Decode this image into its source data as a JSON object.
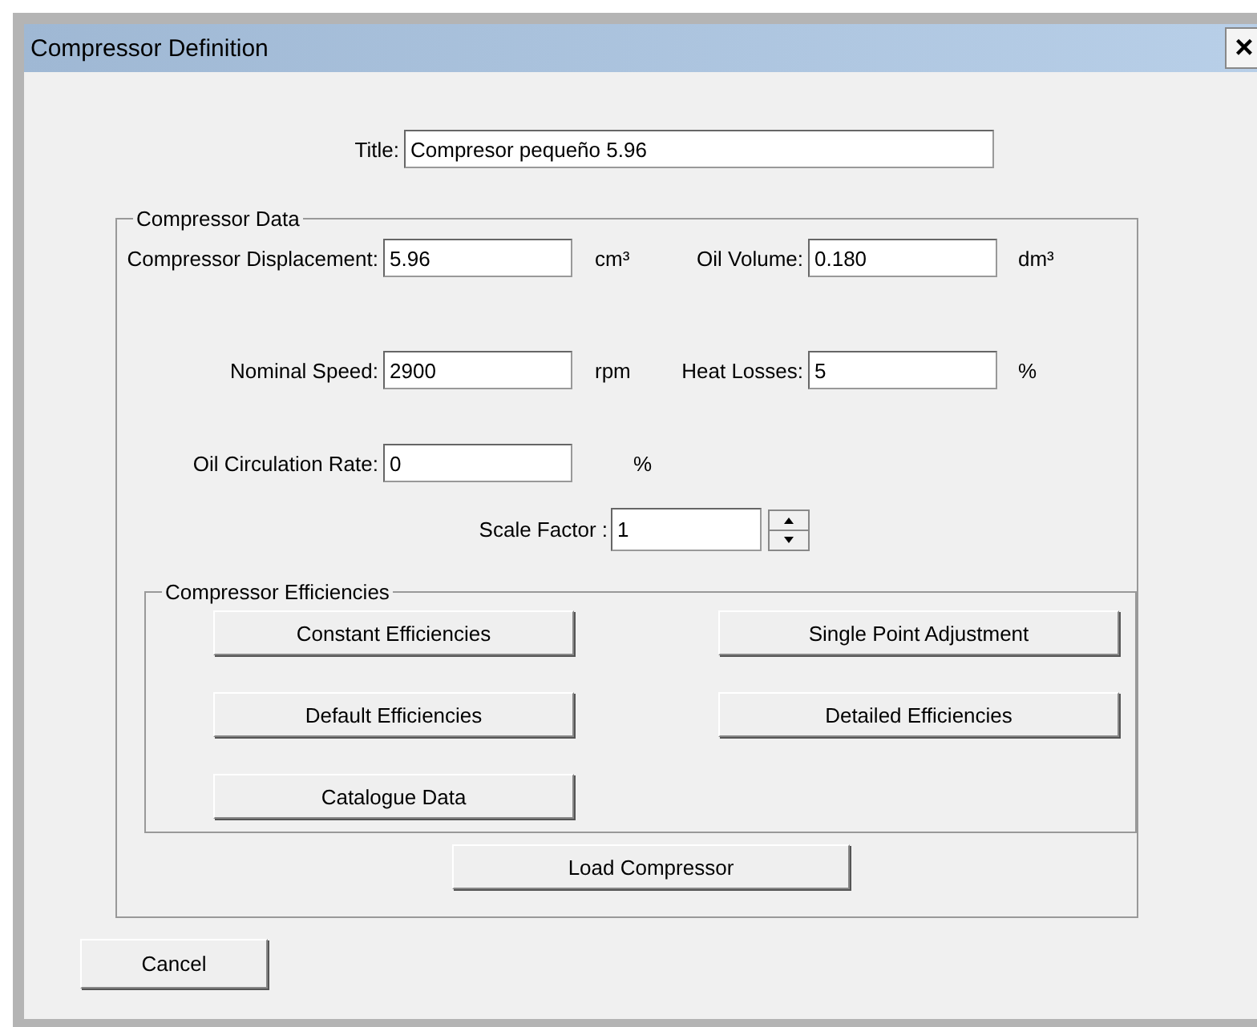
{
  "window": {
    "title": "Compressor Definition",
    "close": "×"
  },
  "title_field": {
    "label": "Title:",
    "value": "Compresor pequeño 5.96"
  },
  "compressor_data": {
    "legend": "Compressor Data",
    "rows": [
      {
        "fields": [
          {
            "label": "Compressor Displacement:",
            "value": "5.96",
            "unit": "cm³"
          },
          {
            "label": "Oil Volume:",
            "value": "0.180",
            "unit": "dm³"
          }
        ]
      },
      {
        "fields": [
          {
            "label": "Nominal Speed:",
            "value": "2900",
            "unit": "rpm"
          },
          {
            "label": "Heat Losses:",
            "value": "5",
            "unit": "%"
          }
        ]
      },
      {
        "fields": [
          {
            "label": "Oil Circulation Rate:",
            "value": "0",
            "unit": "%"
          }
        ]
      }
    ],
    "scale_factor": {
      "label": "Scale Factor :",
      "value": "1"
    },
    "efficiencies": {
      "legend": "Compressor Efficiencies",
      "buttons": [
        "Constant Efficiencies",
        "Single Point Adjustment",
        "Default Efficiencies",
        "Detailed Efficiencies",
        "Catalogue Data"
      ]
    },
    "load_button": "Load Compressor"
  },
  "buttons": [
    "Cancel"
  ]
}
